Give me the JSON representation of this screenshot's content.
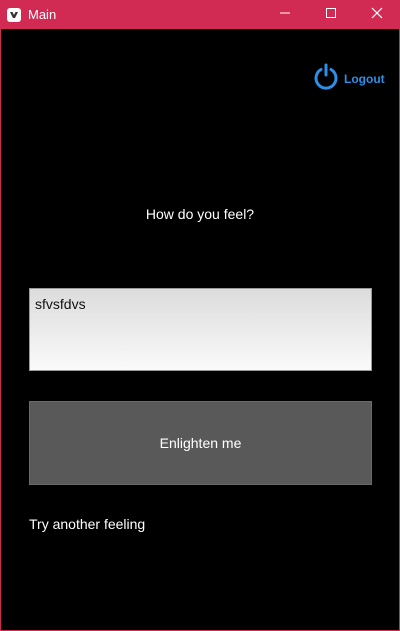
{
  "window": {
    "title": "Main",
    "app_icon": "kivy-icon",
    "controls": [
      "minimize-icon",
      "maximize-icon",
      "close-icon"
    ],
    "accent_color": "#d12b54"
  },
  "header": {
    "logout_label": "Logout",
    "logout_icon": "power-icon",
    "logout_color": "#2e8fe6"
  },
  "main": {
    "question": "How do you feel?",
    "feeling_input_value": "sfvsfdvs",
    "enlighten_button_label": "Enlighten me",
    "try_another_label": "Try another feeling"
  }
}
